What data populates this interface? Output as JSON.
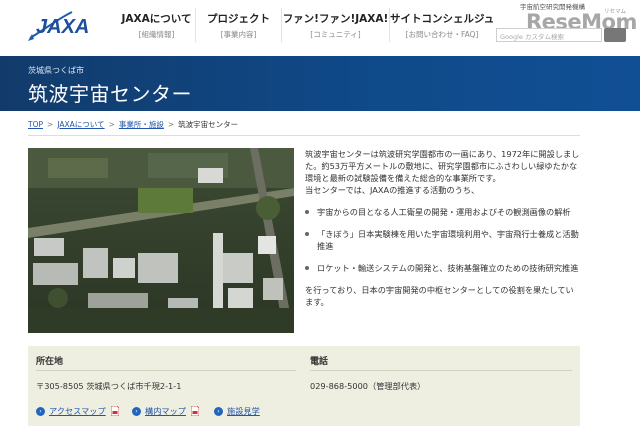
{
  "header": {
    "logo_text": "JAXA",
    "top_link": "宇宙航空研究開発機構",
    "nav": [
      {
        "label": "JAXAについて",
        "sub": "[組織情報]"
      },
      {
        "label": "プロジェクト",
        "sub": "[事業内容]"
      },
      {
        "label": "ファン!ファン!JAXA!",
        "sub": "[コミュニティ]"
      },
      {
        "label": "サイトコンシェルジュ",
        "sub": "[お問い合わせ・FAQ]"
      }
    ],
    "search_placeholder": "Google カスタム検索",
    "watermark": "ReseMom",
    "watermark_sub": "リセマム"
  },
  "banner": {
    "subtitle": "茨城県つくば市",
    "title": "筑波宇宙センター"
  },
  "breadcrumb": [
    {
      "label": "TOP",
      "link": true
    },
    {
      "label": "JAXAについて",
      "link": true
    },
    {
      "label": "事業所・施設",
      "link": true
    },
    {
      "label": "筑波宇宙センター",
      "link": false
    }
  ],
  "breadcrumb_sep": ">",
  "description": {
    "intro_lines": [
      "筑波宇宙センターは筑波研究学園都市の一画にあり、1972年に開設しまし",
      "た。約53万平方メートルの敷地に、研究学園都市にふさわしい緑ゆたかな",
      "環境と最新の試験設備を備えた総合的な事業所です。",
      "当センターでは、JAXAの推進する活動のうち、"
    ],
    "bullets": [
      [
        "宇宙からの目となる人工衛星の開発・運用およびその観測画像の解析"
      ],
      [
        "「きぼう」日本実験棟を用いた宇宙環境利用や、宇宙飛行士養成と活動",
        "推進"
      ],
      [
        "ロケット・輸送システムの開発と、技術基盤確立のための技術研究推進"
      ]
    ],
    "closing_lines": [
      "を行っており、日本の宇宙開発の中枢センターとしての役割を果たしてい",
      "ます。"
    ]
  },
  "info": {
    "address_label": "所在地",
    "address": "〒305-8505 茨城県つくば市千現2-1-1",
    "phone_label": "電話",
    "phone": "029-868-5000（管理部代表）",
    "links": [
      {
        "label": "アクセスマップ",
        "pdf": true
      },
      {
        "label": "構内マップ",
        "pdf": true
      },
      {
        "label": "施設見学",
        "pdf": false
      }
    ]
  },
  "colors": {
    "banner": "#0f4a8a",
    "link": "#2255aa",
    "infobox": "#efefe1"
  }
}
